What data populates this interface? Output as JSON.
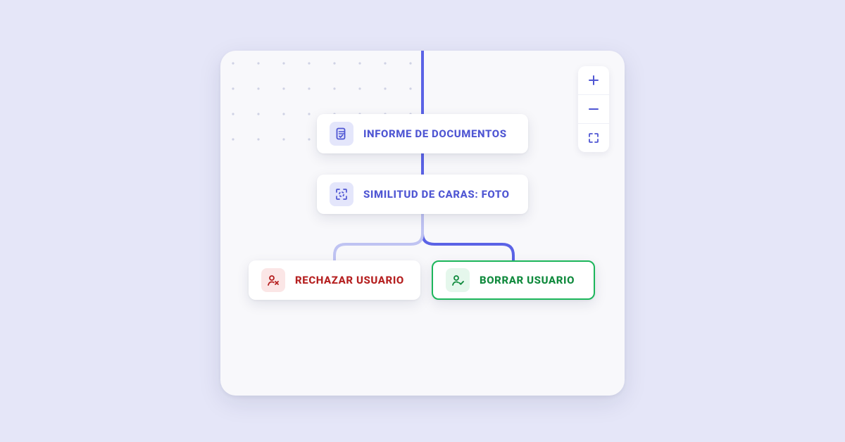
{
  "colors": {
    "indigo": "#4F56D3",
    "green": "#1CB65B",
    "red": "#B52020",
    "page_bg": "#E5E6F8",
    "canvas_bg": "#F8F8FB"
  },
  "zoom_controls": {
    "zoom_in": "+",
    "zoom_out": "−",
    "fullscreen": "⛶"
  },
  "nodes": {
    "document_report": {
      "label": "INFORME DE DOCUMENTOS",
      "icon": "document-check-icon",
      "kind": "indigo"
    },
    "face_similarity": {
      "label": "SIMILITUD DE CARAS: FOTO",
      "icon": "face-scan-icon",
      "kind": "indigo"
    },
    "reject_user": {
      "label": "RECHAZAR USUARIO",
      "icon": "user-reject-icon",
      "kind": "red"
    },
    "clear_user": {
      "label": "BORRAR USUARIO",
      "icon": "user-approve-icon",
      "kind": "green",
      "selected": true
    }
  },
  "edges": [
    {
      "from": "top",
      "to": "document_report"
    },
    {
      "from": "document_report",
      "to": "face_similarity"
    },
    {
      "from": "face_similarity",
      "to": "reject_user",
      "faint": true
    },
    {
      "from": "face_similarity",
      "to": "clear_user"
    }
  ]
}
